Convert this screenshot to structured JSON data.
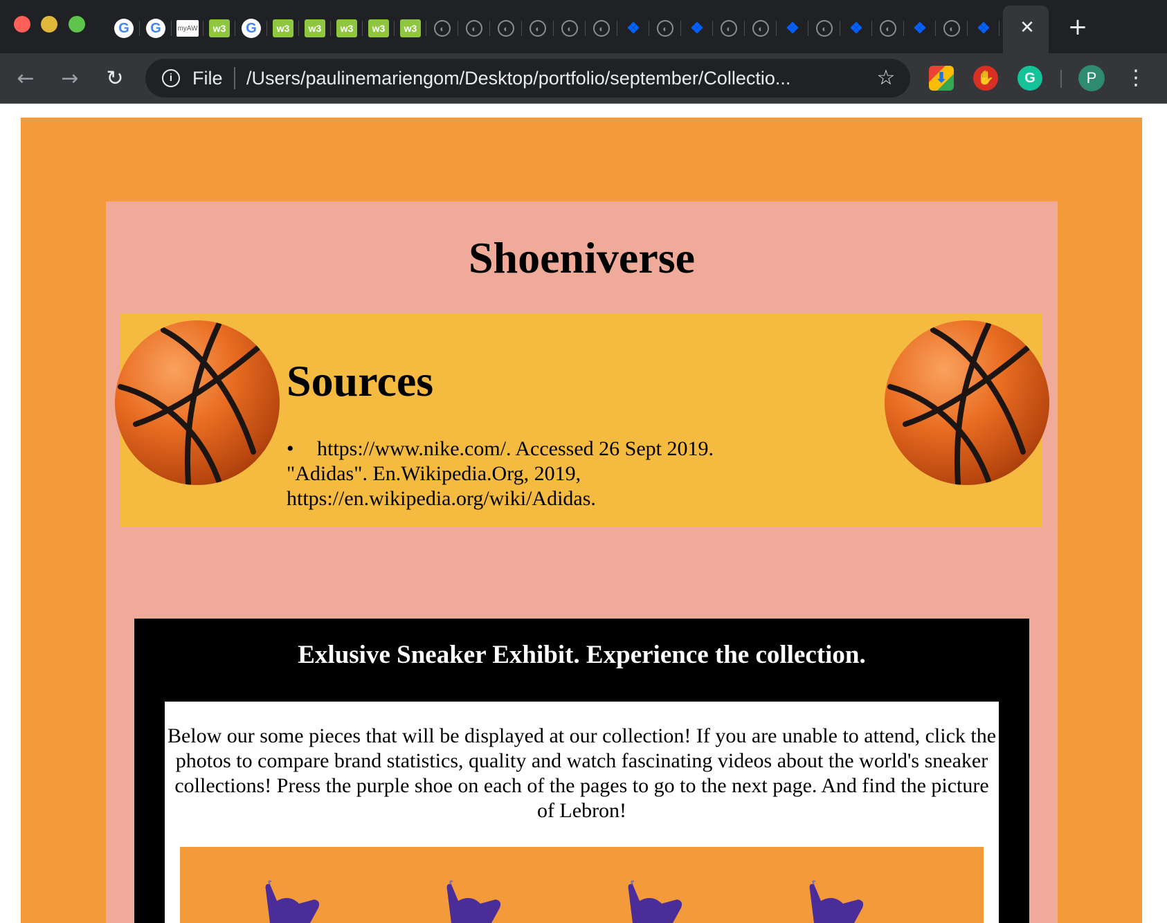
{
  "browser": {
    "tabs": [
      {
        "icon": "google-icon",
        "glyph": "G"
      },
      {
        "icon": "google-icon",
        "glyph": "G"
      },
      {
        "icon": "myaw-icon",
        "glyph": "myAW"
      },
      {
        "icon": "w3schools-icon",
        "glyph": "w3"
      },
      {
        "icon": "google-icon",
        "glyph": "G"
      },
      {
        "icon": "w3schools-icon",
        "glyph": "w3"
      },
      {
        "icon": "w3schools-icon",
        "glyph": "w3"
      },
      {
        "icon": "w3schools-icon",
        "glyph": "w3"
      },
      {
        "icon": "w3schools-icon",
        "glyph": "w3"
      },
      {
        "icon": "w3schools-icon",
        "glyph": "w3"
      },
      {
        "icon": "globe-icon",
        "glyph": "◐"
      },
      {
        "icon": "globe-icon",
        "glyph": "◐"
      },
      {
        "icon": "globe-icon",
        "glyph": "◐"
      },
      {
        "icon": "globe-icon",
        "glyph": "◐"
      },
      {
        "icon": "globe-icon",
        "glyph": "◐"
      },
      {
        "icon": "globe-icon",
        "glyph": "◐"
      },
      {
        "icon": "dropbox-icon",
        "glyph": "❖"
      },
      {
        "icon": "globe-icon",
        "glyph": "◐"
      },
      {
        "icon": "dropbox-icon",
        "glyph": "❖"
      },
      {
        "icon": "globe-icon",
        "glyph": "◐"
      },
      {
        "icon": "globe-icon",
        "glyph": "◐"
      },
      {
        "icon": "dropbox-icon",
        "glyph": "❖"
      },
      {
        "icon": "globe-icon",
        "glyph": "◐"
      },
      {
        "icon": "dropbox-icon",
        "glyph": "❖"
      },
      {
        "icon": "globe-icon",
        "glyph": "◐"
      },
      {
        "icon": "dropbox-icon",
        "glyph": "❖"
      },
      {
        "icon": "globe-icon",
        "glyph": "◐"
      },
      {
        "icon": "dropbox-icon",
        "glyph": "❖"
      }
    ],
    "close_tab_glyph": "✕",
    "new_tab_glyph": "+",
    "back_glyph": "←",
    "forward_glyph": "→",
    "reload_glyph": "↻",
    "info_glyph": "i",
    "scheme_label": "File",
    "url": "/Users/paulinemariengom/Desktop/portfolio/september/Collectio...",
    "bookmark_glyph": "☆",
    "extensions": {
      "downloader_glyph": "⬇",
      "adblock_glyph": "✋",
      "grammarly_glyph": "G"
    },
    "profile_initial": "P",
    "menu_glyph": "⋮"
  },
  "page": {
    "site_title": "Shoeniverse",
    "sources": {
      "heading": "Sources",
      "items": [
        "https://www.nike.com/. Accessed 26 Sept 2019.",
        "\"Adidas\". En.Wikipedia.Org, 2019,",
        "https://en.wikipedia.org/wiki/Adidas."
      ]
    },
    "exhibit": {
      "heading": "Exlusive Sneaker Exhibit. Experience the collection.",
      "description": "Below our some pieces that will be displayed at our collection! If you are unable to attend, click the photos to compare brand statistics, quality and watch fascinating videos about the world's sneaker collections! Press the purple shoe on each of the pages to go to the next page. And find the picture of Lebron!"
    },
    "colors": {
      "page_background": "#f39a3a",
      "panel_background": "#f0aa99",
      "sources_background": "#f5bb40",
      "exhibit_background": "#000000",
      "shoe_purple": "#4b2d9a"
    }
  }
}
